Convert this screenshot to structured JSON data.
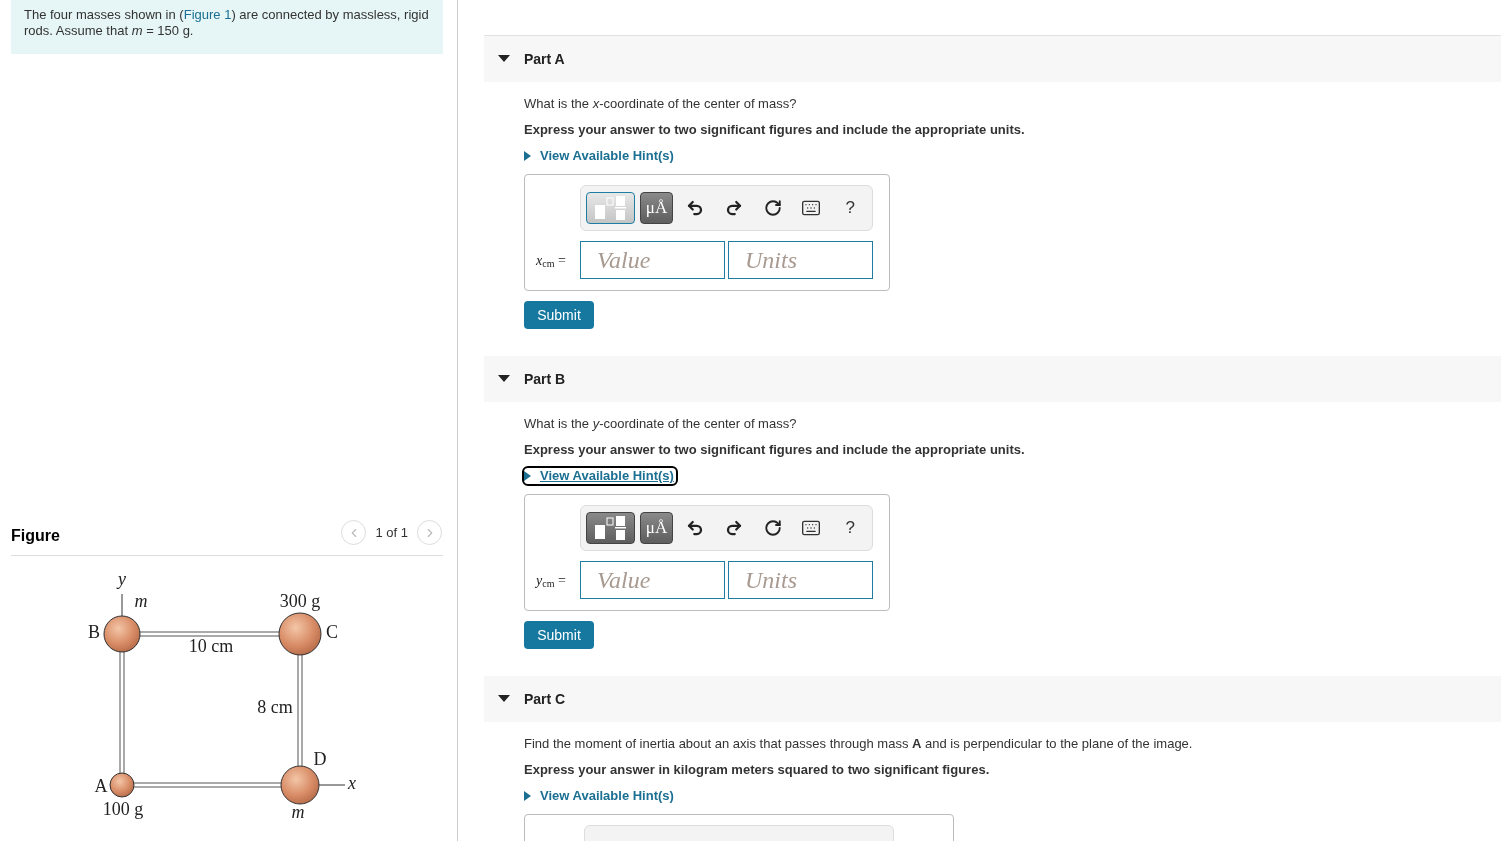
{
  "intro": {
    "before": "The four masses shown in (",
    "link": "Figure 1",
    "after": ") are connected by massless, rigid rods. Assume that *m* = 150 g."
  },
  "figure": {
    "title": "Figure",
    "pager": "1 of 1",
    "labels": [
      "y",
      "m",
      "300 g",
      "B",
      "C",
      "10 cm",
      "8 cm",
      "D",
      "x",
      "A",
      "100 g",
      "m"
    ]
  },
  "parts": [
    {
      "label": "Part A",
      "expanded": true,
      "question": "What is the *x*-coordinate of the center of mass?",
      "instruction": "Express your answer to two significant figures and include the appropriate units.",
      "hint": "View Available Hint(s)",
      "hint_focused": false,
      "answer": {
        "kind": "full",
        "variable": "x",
        "subscript": "cm",
        "equals": "=",
        "template_selected": true,
        "units_symbol": "μÅ",
        "help": "?",
        "value_placeholder": "Value",
        "units_placeholder": "Units"
      },
      "submit": "Submit"
    },
    {
      "label": "Part B",
      "expanded": true,
      "question": "What is the *y*-coordinate of the center of mass?",
      "instruction": "Express your answer to two significant figures and include the appropriate units.",
      "hint": "View Available Hint(s)",
      "hint_focused": true,
      "answer": {
        "kind": "full",
        "variable": "y",
        "subscript": "cm",
        "equals": "=",
        "template_selected": false,
        "units_symbol": "μÅ",
        "help": "?",
        "value_placeholder": "Value",
        "units_placeholder": "Units"
      },
      "submit": "Submit"
    },
    {
      "label": "Part C",
      "expanded": true,
      "question": "Find the moment of inertia about an axis that passes through mass **A** and is perpendicular to the plane of the image.",
      "instruction": "Express your answer in kilogram meters squared to two significant figures.",
      "hint": "View Available Hint(s)",
      "hint_focused": false,
      "answer": {
        "kind": "cut"
      }
    }
  ]
}
